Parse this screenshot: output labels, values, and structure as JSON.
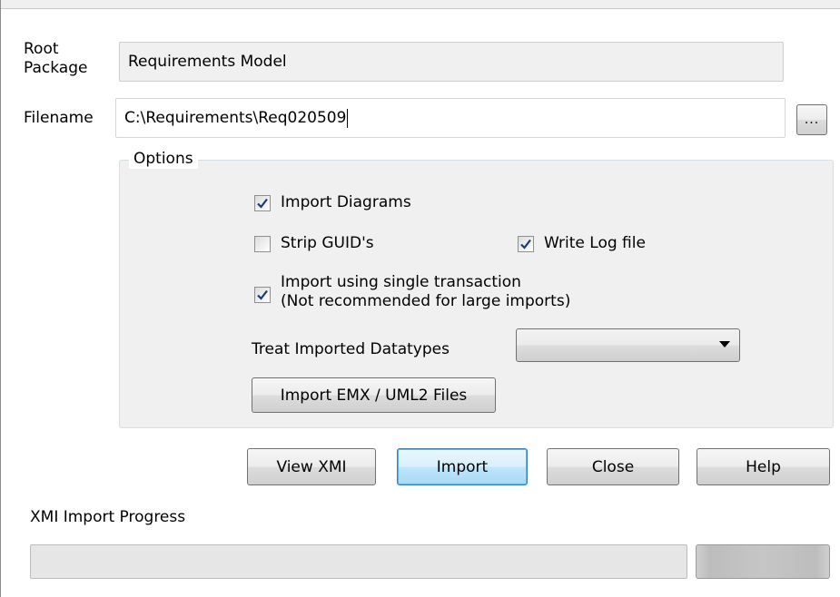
{
  "root_package": {
    "label_line1": "Root",
    "label_line2": "Package",
    "value": "Requirements Model"
  },
  "filename": {
    "label": "Filename",
    "value": "C:\\Requirements\\Req020509",
    "browse_label": "..."
  },
  "options": {
    "title": "Options",
    "import_diagrams": {
      "label": "Import Diagrams",
      "checked": true
    },
    "strip_guids": {
      "label": "Strip GUID's",
      "checked": false
    },
    "write_log_file": {
      "label": "Write Log file",
      "checked": true
    },
    "single_transaction": {
      "label_line1": "Import using single transaction",
      "label_line2": "(Not recommended for large imports)",
      "checked": true
    },
    "treat_datatypes": {
      "label": "Treat Imported Datatypes",
      "selected": ""
    },
    "import_emx_label": "Import EMX / UML2 Files"
  },
  "actions": {
    "view_xmi": "View XMI",
    "import": "Import",
    "close": "Close",
    "help": "Help"
  },
  "progress": {
    "label": "XMI Import Progress",
    "value": 0
  },
  "colors": {
    "check": "#1a3a73",
    "default_button_border": "#3c7fb1"
  }
}
